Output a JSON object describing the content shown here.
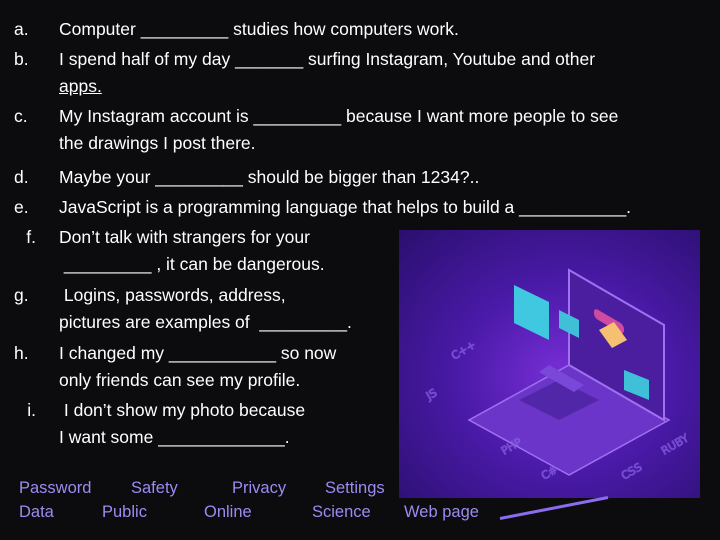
{
  "questions": [
    {
      "label": "a.",
      "lines": [
        "Computer _________ studies how computers work."
      ]
    },
    {
      "label": "b.",
      "lines": [
        "I spend half of my day _______ surfing Instagram, Youtube and other",
        "apps."
      ]
    },
    {
      "label": "c.",
      "lines": [
        "My Instagram account is _________ because I want more people to see",
        "the drawings I post there."
      ]
    },
    {
      "label": "d.",
      "lines": [
        "Maybe your _________ should be bigger than 1234?.."
      ]
    },
    {
      "label": "e.",
      "lines": [
        "JavaScript is a programming language that helps to build a ___________."
      ]
    },
    {
      "label": "f.",
      "lines": [
        "Don’t talk with strangers for your",
        " _________ , it can be dangerous."
      ]
    },
    {
      "label": "g.",
      "lines": [
        " Logins, passwords, address,",
        "pictures are examples of  _________."
      ]
    },
    {
      "label": "h.",
      "lines": [
        "I changed my ___________ so now",
        "only friends can see my profile."
      ]
    },
    {
      "label": "i.",
      "lines": [
        " I don’t show my photo because",
        "I want some _____________."
      ]
    }
  ],
  "word_bank": {
    "row1": [
      "Password",
      "Safety",
      "Privacy",
      "Settings"
    ],
    "row2": [
      "Data",
      "Public",
      "Online",
      "Science",
      "Web page"
    ]
  },
  "illustration": {
    "code_labels": [
      "C++",
      "JS",
      "PHP",
      "C#",
      "CSS",
      "RUBY"
    ],
    "accent": "#7a2fd8"
  },
  "colors": {
    "word_bank": "#9c8cf2",
    "background": "#0c0b0d"
  }
}
